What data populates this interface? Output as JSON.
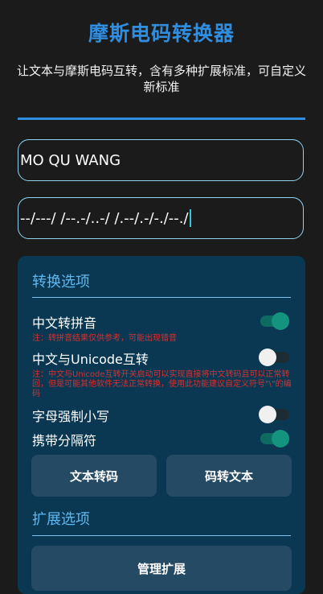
{
  "header": {
    "title": "摩斯电码转换器",
    "subtitle": "让文本与摩斯电码互转，含有多种扩展标准，可自定义新标准"
  },
  "inputs": {
    "text_value": "MO QU WANG",
    "morse_value": "--/---/ /--.-/..-/ /.--/.-/-./--./"
  },
  "conversion_options": {
    "title": "转换选项",
    "pinyin_label": "中文转拼音",
    "pinyin_on": true,
    "pinyin_note": "注：转拼音结果仅供参考，可能出现错音",
    "unicode_label": "中文与Unicode互转",
    "unicode_on": false,
    "unicode_note": "注：中文与Unicode互转开关启动可以实现直接将中文转码且可以正常转回，但是可能其他软件无法正常转换，使用此功能建议自定义符号\"\\\"的编码",
    "lowercase_label": "字母强制小写",
    "lowercase_on": false,
    "separator_label": "携带分隔符",
    "separator_on": true
  },
  "actions": {
    "encode_label": "文本转码",
    "decode_label": "码转文本"
  },
  "extension_options": {
    "title": "扩展选项",
    "manage_label": "管理扩展"
  },
  "colors": {
    "accent": "#2f8ee0",
    "panel": "#0a3852",
    "note": "#d83030",
    "switch_on": "#14937f"
  }
}
